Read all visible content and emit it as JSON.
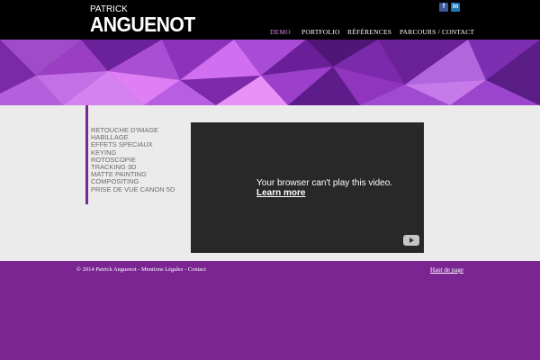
{
  "brand": {
    "line1": "PATRICK",
    "line2": "ANGUENOT"
  },
  "social": {
    "facebook": "f",
    "linkedin": "in"
  },
  "nav": [
    {
      "label": "DEMO",
      "active": true
    },
    {
      "label": "PORTFOLIO",
      "active": false
    },
    {
      "label": "RÉFÉRENCES",
      "active": false
    },
    {
      "label": "PARCOURS / CONTACT",
      "active": false
    }
  ],
  "menu": [
    "RETOUCHE D'IMAGE",
    "HABILLAGE",
    "EFFETS SPECIAUX",
    "KEYING",
    "ROTOSCOPIE",
    "TRACKING 3D",
    "MATTE PAINTING",
    "COMPOSITING",
    "PRISE DE VUE CANON 5D"
  ],
  "video": {
    "message": "Your browser can't play this video.",
    "link": "Learn more",
    "logo_icon": "youtube-icon"
  },
  "footer": {
    "copyright": "© 2014 Patrick Anguenot",
    "sep": " - ",
    "legal": "Mentions Légales",
    "contact": "Contact",
    "top_link": "Haut de page"
  },
  "colors": {
    "header": "#000000",
    "accent": "#7a2592",
    "nav_active": "#d68be8",
    "content_bg": "#ebebeb",
    "video_bg": "#282828"
  }
}
